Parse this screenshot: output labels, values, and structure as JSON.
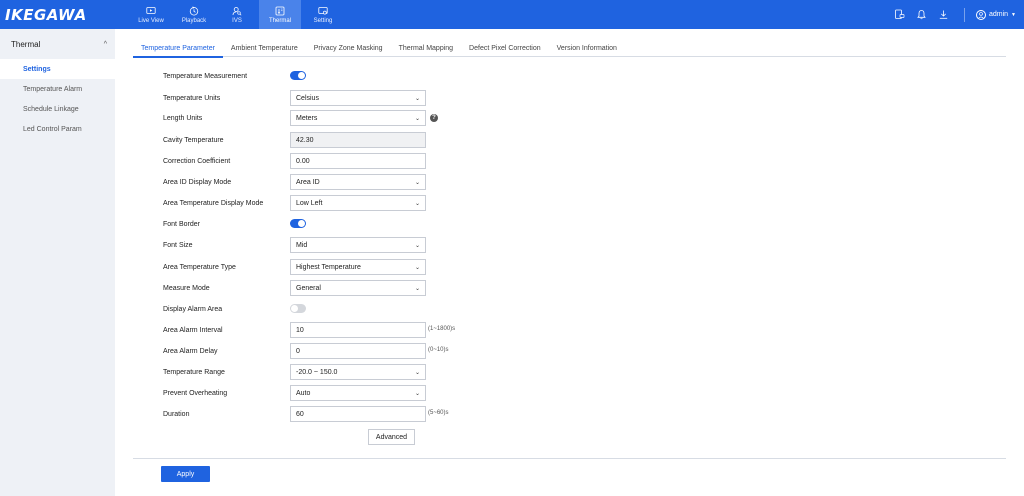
{
  "brand": {
    "logo_text": "IKEGAWA",
    "bar_color": "#1f63e0"
  },
  "nav": {
    "items": [
      {
        "label": "Live View",
        "icon": "monitor-play-icon"
      },
      {
        "label": "Playback",
        "icon": "clock-replay-icon"
      },
      {
        "label": "IVS",
        "icon": "person-search-icon"
      },
      {
        "label": "Thermal",
        "icon": "thermal-icon",
        "active": true
      },
      {
        "label": "Setting",
        "icon": "settings-monitor-icon"
      }
    ]
  },
  "top_right": {
    "user": "admin"
  },
  "sidebar": {
    "section": "Thermal",
    "items": [
      {
        "label": "Settings",
        "active": true
      },
      {
        "label": "Temperature Alarm"
      },
      {
        "label": "Schedule Linkage"
      },
      {
        "label": "Led Control Param"
      }
    ]
  },
  "tabs": [
    {
      "label": "Temperature Parameter",
      "active": true
    },
    {
      "label": "Ambient Temperature"
    },
    {
      "label": "Privacy Zone Masking"
    },
    {
      "label": "Thermal Mapping"
    },
    {
      "label": "Defect Pixel Correction"
    },
    {
      "label": "Version Information"
    }
  ],
  "form": {
    "temperature_measurement": {
      "label": "Temperature Measurement",
      "on": true
    },
    "temperature_units": {
      "label": "Temperature Units",
      "value": "Celsius"
    },
    "length_units": {
      "label": "Length Units",
      "value": "Meters",
      "help": "?"
    },
    "cavity_temperature": {
      "label": "Cavity Temperature",
      "value": "42.30"
    },
    "correction_coefficient": {
      "label": "Correction Coefficient",
      "value": "0.00"
    },
    "area_id_display_mode": {
      "label": "Area ID Display Mode",
      "value": "Area ID"
    },
    "area_temp_display_mode": {
      "label": "Area Temperature Display Mode",
      "value": "Low Left"
    },
    "font_border": {
      "label": "Font Border",
      "on": true
    },
    "font_size": {
      "label": "Font Size",
      "value": "Mid"
    },
    "area_temperature_type": {
      "label": "Area Temperature Type",
      "value": "Highest Temperature"
    },
    "measure_mode": {
      "label": "Measure Mode",
      "value": "General"
    },
    "display_alarm_area": {
      "label": "Display Alarm Area",
      "on": false
    },
    "area_alarm_interval": {
      "label": "Area Alarm Interval",
      "value": "10",
      "hint": "(1~1800)s"
    },
    "area_alarm_delay": {
      "label": "Area Alarm Delay",
      "value": "0",
      "hint": "(0~10)s"
    },
    "temperature_range": {
      "label": "Temperature Range",
      "value": "-20.0 ~ 150.0"
    },
    "prevent_overheating": {
      "label": "Prevent Overheating",
      "value": "Auto"
    },
    "duration": {
      "label": "Duration",
      "value": "60",
      "hint": "(5~60)s"
    }
  },
  "buttons": {
    "advanced": "Advanced",
    "apply": "Apply"
  }
}
